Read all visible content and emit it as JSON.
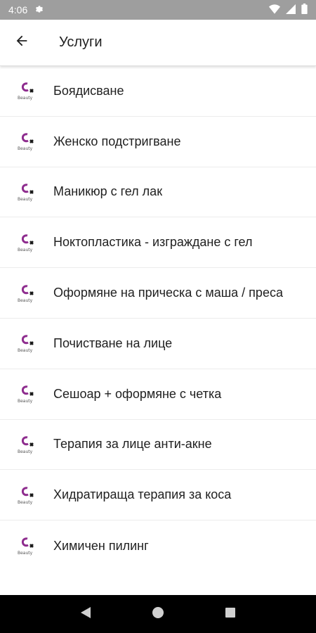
{
  "status_bar": {
    "time": "4:06",
    "icons": [
      "settings-icon",
      "wifi-icon",
      "signal-icon",
      "battery-icon"
    ]
  },
  "app_bar": {
    "title": "Услуги",
    "back_icon": "arrow-left-icon"
  },
  "services": [
    {
      "label": "Боядисване"
    },
    {
      "label": "Женско подстригване"
    },
    {
      "label": "Маникюр с гел лак"
    },
    {
      "label": "Ноктопластика - изграждане с гел"
    },
    {
      "label": "Оформяне на прическа с маша / преса"
    },
    {
      "label": "Почистване на лице"
    },
    {
      "label": "Сешоар + оформяне с четка"
    },
    {
      "label": "Терапия за лице анти-акне"
    },
    {
      "label": "Хидратираща терапия за коса"
    },
    {
      "label": "Химичен пилинг"
    }
  ],
  "logo": {
    "text": "Beauty",
    "colors": {
      "primary": "#8e2c8e",
      "secondary": "#1a1a1a"
    }
  },
  "nav_bar": {
    "icons": [
      "back-triangle-icon",
      "home-circle-icon",
      "recents-square-icon"
    ]
  },
  "colors": {
    "status_bar": "#9e9e9e",
    "nav_bar": "#000000",
    "text": "#212121",
    "divider": "#ececec"
  }
}
